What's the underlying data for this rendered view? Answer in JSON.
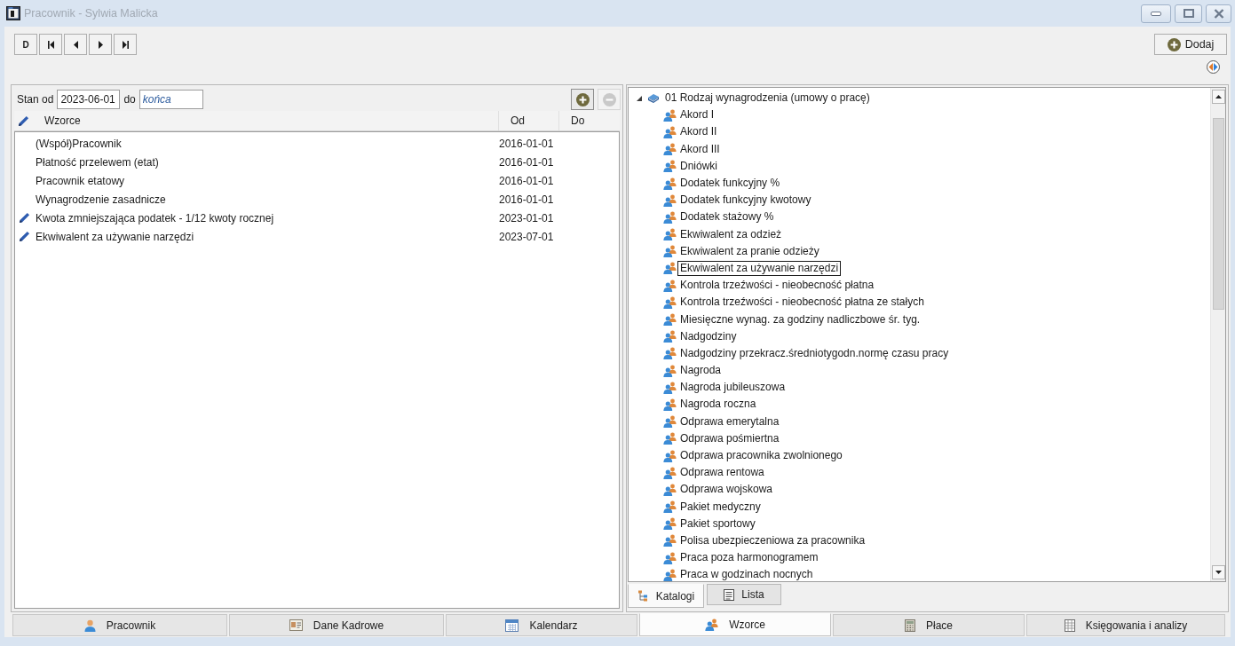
{
  "window": {
    "title": "Pracownik - Sylwia Malicka"
  },
  "toolbar": {
    "first_button": {
      "label": "D"
    },
    "add_button": {
      "label": "Dodaj"
    }
  },
  "filter": {
    "from_label": "Stan od",
    "from_date": {
      "value": "2023-06-01"
    },
    "to_label": "do",
    "to_date": {
      "value": "końca"
    },
    "buttons": [
      {
        "kind": "add",
        "disabled": false
      },
      {
        "kind": "remove",
        "disabled": true
      }
    ]
  },
  "table": {
    "columns": [
      "Wzorce",
      "Od",
      "Do"
    ],
    "rows": [
      {
        "name": "(Współ)Pracownik",
        "from": "2016-01-01",
        "edited": false
      },
      {
        "name": "Płatność przelewem (etat)",
        "from": "2016-01-01",
        "edited": false
      },
      {
        "name": "Pracownik etatowy",
        "from": "2016-01-01",
        "edited": false
      },
      {
        "name": "Wynagrodzenie zasadnicze",
        "from": "2016-01-01",
        "edited": false
      },
      {
        "name": "Kwota zmniejszająca podatek - 1/12 kwoty rocznej",
        "from": "2023-01-01",
        "edited": true
      },
      {
        "name": "Ekwiwalent za używanie narzędzi",
        "from": "2023-07-01",
        "edited": true
      }
    ]
  },
  "tree": {
    "root": {
      "label": "01 Rodzaj wynagrodzenia (umowy o pracę)",
      "expanded": true,
      "selected": false,
      "children": [
        {
          "label": "Akord I",
          "selected": false
        },
        {
          "label": "Akord II",
          "selected": false
        },
        {
          "label": "Akord III",
          "selected": false
        },
        {
          "label": "Dniówki",
          "selected": false
        },
        {
          "label": "Dodatek funkcyjny %",
          "selected": false
        },
        {
          "label": "Dodatek funkcyjny kwotowy",
          "selected": false
        },
        {
          "label": "Dodatek stażowy %",
          "selected": false
        },
        {
          "label": "Ekwiwalent za odzież",
          "selected": false
        },
        {
          "label": "Ekwiwalent za pranie odzieży",
          "selected": false
        },
        {
          "label": "Ekwiwalent za używanie narzędzi",
          "selected": true
        },
        {
          "label": "Kontrola trzeźwości - nieobecność płatna",
          "selected": false
        },
        {
          "label": "Kontrola trzeźwości - nieobecność płatna ze stałych",
          "selected": false
        },
        {
          "label": "Miesięczne wynag. za godziny nadliczbowe śr. tyg.",
          "selected": false
        },
        {
          "label": "Nadgodziny",
          "selected": false
        },
        {
          "label": "Nadgodziny przekracz.średniotygodn.normę czasu pracy",
          "selected": false
        },
        {
          "label": "Nagroda",
          "selected": false
        },
        {
          "label": "Nagroda jubileuszowa",
          "selected": false
        },
        {
          "label": "Nagroda roczna",
          "selected": false
        },
        {
          "label": "Odprawa emerytalna",
          "selected": false
        },
        {
          "label": "Odprawa pośmiertna",
          "selected": false
        },
        {
          "label": "Odprawa pracownika zwolnionego",
          "selected": false
        },
        {
          "label": "Odprawa rentowa",
          "selected": false
        },
        {
          "label": "Odprawa wojskowa",
          "selected": false
        },
        {
          "label": "Pakiet medyczny",
          "selected": false
        },
        {
          "label": "Pakiet sportowy",
          "selected": false
        },
        {
          "label": "Polisa ubezpieczeniowa za pracownika",
          "selected": false
        },
        {
          "label": "Praca poza harmonogramem",
          "selected": false
        },
        {
          "label": "Praca w godzinach nocnych",
          "selected": false
        }
      ]
    }
  },
  "panel_tabs": [
    {
      "label": "Katalogi",
      "selected": true
    },
    {
      "label": "Lista",
      "selected": false
    }
  ],
  "main_tabs": [
    {
      "label": "Pracownik",
      "selected": false
    },
    {
      "label": "Dane Kadrowe",
      "selected": false
    },
    {
      "label": "Kalendarz",
      "selected": false
    },
    {
      "label": "Wzorce",
      "selected": true
    },
    {
      "label": "Płace",
      "selected": false
    },
    {
      "label": "Księgowania i analizy",
      "selected": false
    }
  ]
}
